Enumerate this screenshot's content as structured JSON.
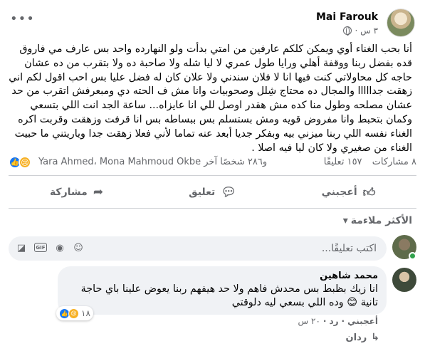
{
  "post": {
    "author": "Mai Farouk",
    "time": "٣ س ·",
    "more_label": "•••",
    "body": "أنا بحب الغناء أوي ويمكن كلكم عارفين من امتي بدأت ولو النهارده واحد بس عارف مي فاروق قده بفضل ربنا ووقفة أهلي ورايا طول عمري لا ليا شله ولا صاحبة ده ولا بتقرب من ده عشان حاجه كل محاولاتي كنت فيها انا لا فلان سندني ولا علان كان له فضل عليا بس احب اقول لكم اني زهقت جدااااا والمجال ده محتاج شِلل وصحوبيات وانا مش ف الحته دي ومبعرفش اتقرب من حد عشان مصلحه وطول منا كده مش هقدر اوصل للي انا عايزاه... ساعة الجد انت اللي بتسعي وكمان بتحبط وانا مفروض قويه ومش بستسلم بس ببساطه بس انا قرفت وزهقت وقربت اكره الغناء نفسه اللي ربنا ميزني بيه وبفكر جديا أبعد عنه تماما لأني فعلا زهقت جدا وياريتني ما حبيت الغناء من صغيري ولا كان ليا فيه اصلا ."
  },
  "reactions": {
    "reactors": "Yara Ahmed، Mona Mahmoud Okbe و٢٨٦ شخصًا آخر",
    "comments": "١٥٧ تعليقًا",
    "shares": "٨ مشاركات"
  },
  "actions": {
    "like": "أعجبني",
    "comment": "تعليق",
    "share": "مشاركة"
  },
  "sort": {
    "label": "الأكثر ملاءمة"
  },
  "composer": {
    "placeholder": "اكتب تعليقًا..."
  },
  "comment": {
    "author": "محمد شاهين",
    "text": "انا زيك بظبط بس محدش فاهم ولا حد هيفهم ربنا يعوض علينا باي حاجة تانية 😊 وده اللي بسعي ليه دلوقتي",
    "reaction_count": "١٨",
    "like": "أعجبني",
    "reply": "رد",
    "time": "٢٠ س"
  },
  "replies": {
    "label": "ردان"
  },
  "colors": {
    "like_blue": "#1877f2",
    "sad_yellow": "#f7b125",
    "meta_gray": "#65676b",
    "bubble_bg": "#f0f2f5",
    "online_green": "#31a24c"
  },
  "icons": [
    "globe-icon",
    "more-icon",
    "like-reaction-icon",
    "sad-reaction-icon",
    "thumbs-up-icon",
    "comment-icon",
    "share-icon",
    "chevron-down-icon",
    "sticker-icon",
    "gif-icon",
    "camera-icon",
    "emoji-icon",
    "reply-arrow-icon"
  ]
}
